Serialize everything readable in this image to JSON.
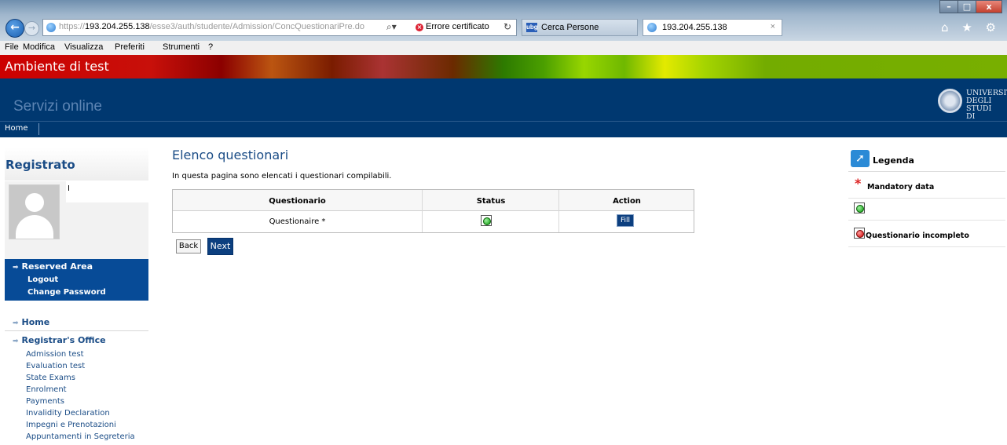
{
  "browser": {
    "url_prefix": "https://",
    "url_host": "193.204.255.138",
    "url_path": "/esse3/auth/studente/Admission/ConcQuestionariPre.do",
    "search_icon": "search-icon",
    "cert_error": "Errore certificato",
    "tabs": [
      {
        "label": "Cerca Persone",
        "icon": "ubg-icon",
        "icon_text": "ubg"
      },
      {
        "label": "193.204.255.138",
        "icon": "ie-icon",
        "close": "×"
      }
    ],
    "window_buttons": {
      "minimize": "–",
      "maximize": "□",
      "close": "x"
    },
    "tools": "⌂ ★ ⚙"
  },
  "menubar": [
    "File",
    "Modifica",
    "Visualizza",
    "Preferiti",
    "Strumenti",
    "?"
  ],
  "site": {
    "test_banner": "Ambiente di test",
    "services_title": "Servizi online",
    "university": [
      "UNIVERSITA'",
      "DEGLI STUDI",
      "DI BERGAMO"
    ],
    "nav_home": "Home"
  },
  "sidebar": {
    "title": "Registrato",
    "name_initial": "I",
    "reserved": {
      "title": "Reserved Area",
      "links": [
        "Logout",
        "Change Password"
      ]
    },
    "home": "Home",
    "registrar": {
      "title": "Registrar's Office",
      "items": [
        "Admission test",
        "Evaluation test",
        "State Exams",
        "Enrolment",
        "Payments",
        "Invalidity Declaration",
        "Impegni e Prenotazioni",
        "Appuntamenti in Segreteria"
      ]
    }
  },
  "main": {
    "title": "Elenco questionari",
    "intro": "In questa pagina sono elencati i questionari compilabili.",
    "table": {
      "headers": [
        "Questionario",
        "Status",
        "Action"
      ],
      "rows": [
        {
          "questionario": "Questionaire *",
          "status": "green",
          "action": "Fill"
        }
      ]
    },
    "back_label": "Back",
    "next_label": "Next"
  },
  "legend": {
    "title": "Legenda",
    "mandatory_mark": "*",
    "mandatory": "Mandatory data",
    "incomplete": "Questionario incompleto"
  },
  "colors": {
    "brand_blue": "#003870",
    "link_blue": "#1a4c86",
    "status_ok": "#0a9a0a",
    "status_incomplete": "#cc0000"
  }
}
